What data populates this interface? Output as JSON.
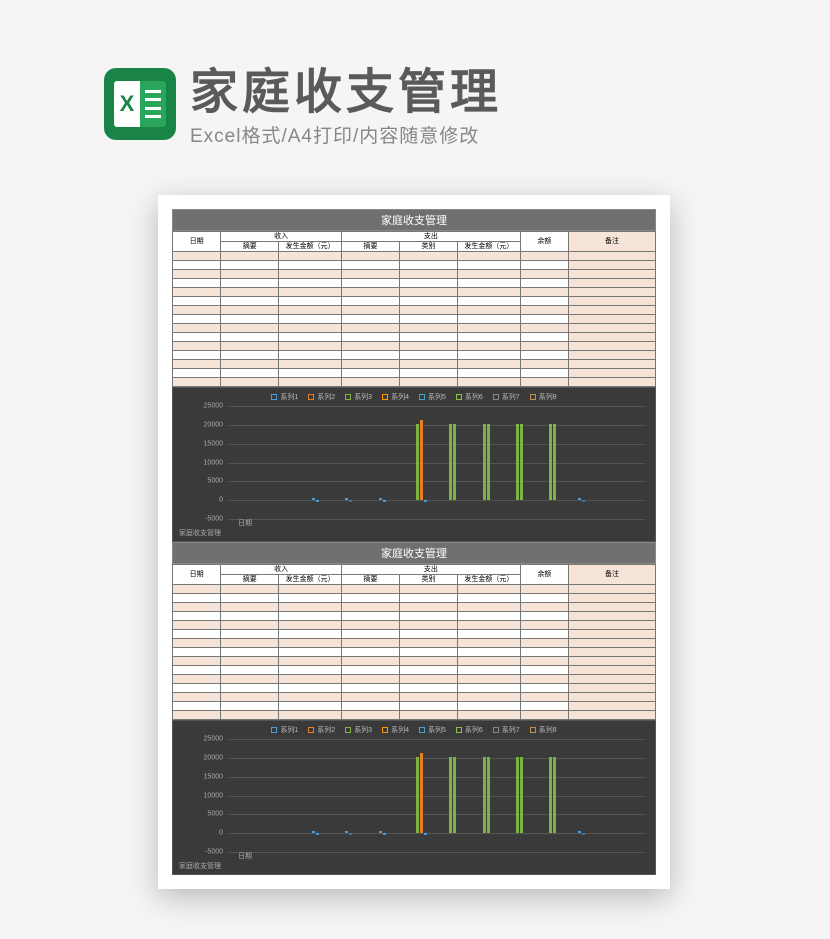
{
  "header": {
    "title": "家庭收支管理",
    "subtitle": "Excel格式/A4打印/内容随意修改",
    "icon_letter": "X"
  },
  "sheet": {
    "title": "家庭收支管理",
    "columns": {
      "date": "日期",
      "income_group": "收入",
      "income_desc": "摘要",
      "income_amt": "发生金额（元）",
      "expense_group": "支出",
      "expense_desc": "摘要",
      "expense_cat": "类别",
      "expense_amt": "发生金额（元）",
      "balance": "余额",
      "note": "备注"
    },
    "row_count": 15,
    "x_axis_labels": [
      "家庭收支管理",
      "日期"
    ]
  },
  "chart_data": {
    "type": "bar",
    "title": "",
    "xlabel": "",
    "ylabel": "",
    "ylim": [
      -5000,
      25000
    ],
    "yticks": [
      -5000,
      0,
      5000,
      10000,
      15000,
      20000,
      25000
    ],
    "series": [
      {
        "name": "系列1",
        "color": "#4a9fd8"
      },
      {
        "name": "系列2",
        "color": "#e67e22"
      },
      {
        "name": "系列3",
        "color": "#7cb342"
      },
      {
        "name": "系列4",
        "color": "#ff9800"
      },
      {
        "name": "系列5",
        "color": "#42a5c5"
      },
      {
        "name": "系列6",
        "color": "#8bc34a"
      },
      {
        "name": "系列7",
        "color": "#888888"
      },
      {
        "name": "系列8",
        "color": "#c09050"
      }
    ],
    "groups": [
      {
        "x_pct": 20,
        "values": [
          500,
          -500
        ]
      },
      {
        "x_pct": 28,
        "values": [
          600,
          -400
        ]
      },
      {
        "x_pct": 36,
        "values": [
          500,
          -500
        ]
      },
      {
        "x_pct": 45,
        "values": [
          20000,
          21000,
          -500
        ]
      },
      {
        "x_pct": 53,
        "values": [
          20000,
          20000
        ]
      },
      {
        "x_pct": 61,
        "values": [
          20000,
          20000
        ]
      },
      {
        "x_pct": 69,
        "values": [
          20000,
          20000
        ]
      },
      {
        "x_pct": 77,
        "values": [
          20000,
          20000
        ]
      },
      {
        "x_pct": 84,
        "values": [
          600,
          -400
        ]
      }
    ]
  }
}
